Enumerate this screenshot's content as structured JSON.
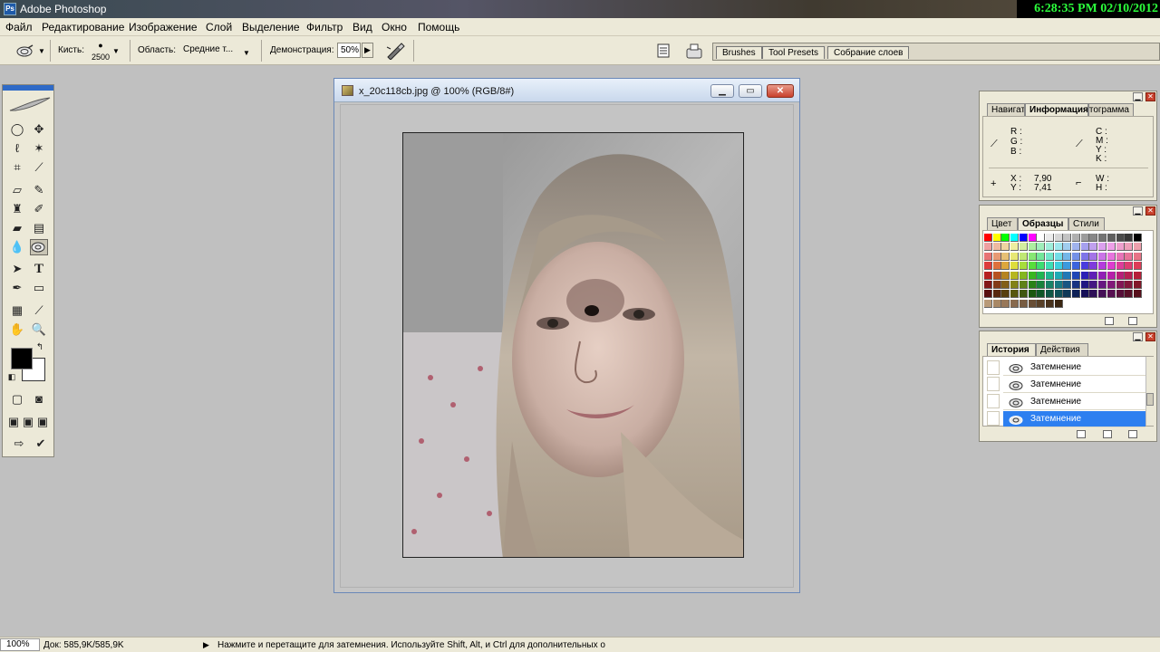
{
  "app": {
    "title": "Adobe Photoshop",
    "clock": "6:28:35 PM 02/10/2012"
  },
  "menu": [
    "Файл",
    "Редактирование",
    "Изображение",
    "Слой",
    "Выделение",
    "Фильтр",
    "Вид",
    "Окно",
    "Помощь"
  ],
  "options": {
    "brush_label": "Кисть:",
    "brush_size": "2500",
    "range_label": "Область:",
    "range_value": "Средние т...",
    "exposure_label": "Демонстрация:",
    "exposure_value": "50%"
  },
  "palette_well": {
    "tabs": [
      "Brushes",
      "Tool Presets",
      "Собрание слоев"
    ]
  },
  "document": {
    "title": "x_20c118cb.jpg @ 100% (RGB/8#)"
  },
  "info_palette": {
    "tabs": [
      "Навигатор",
      "Информация",
      "Гистограмма"
    ],
    "rgb_labels": [
      "R :",
      "G :",
      "B :"
    ],
    "cmyk_labels": [
      "C :",
      "M :",
      "Y :",
      "K :"
    ],
    "x_label": "X :",
    "x_value": "7,90",
    "y_label": "Y :",
    "y_value": "7,41",
    "w_label": "W :",
    "h_label": "H :"
  },
  "swatches_palette": {
    "tabs": [
      "Цвет",
      "Образцы",
      "Стили"
    ]
  },
  "history_palette": {
    "tabs": [
      "История",
      "Действия"
    ],
    "items": [
      "Затемнение",
      "Затемнение",
      "Затемнение",
      "Затемнение"
    ],
    "selected_index": 3
  },
  "status": {
    "zoom": "100%",
    "doc": "Док: 585,9K/585,9K",
    "hint": "Нажмите и перетащите для затемнения.  Используйте Shift, Alt, и Ctrl для дополнительных о"
  },
  "colors": {
    "foreground": "#000000",
    "background": "#ffffff",
    "selection": "#2d7ff0",
    "clock_text": "#2cff3c"
  }
}
